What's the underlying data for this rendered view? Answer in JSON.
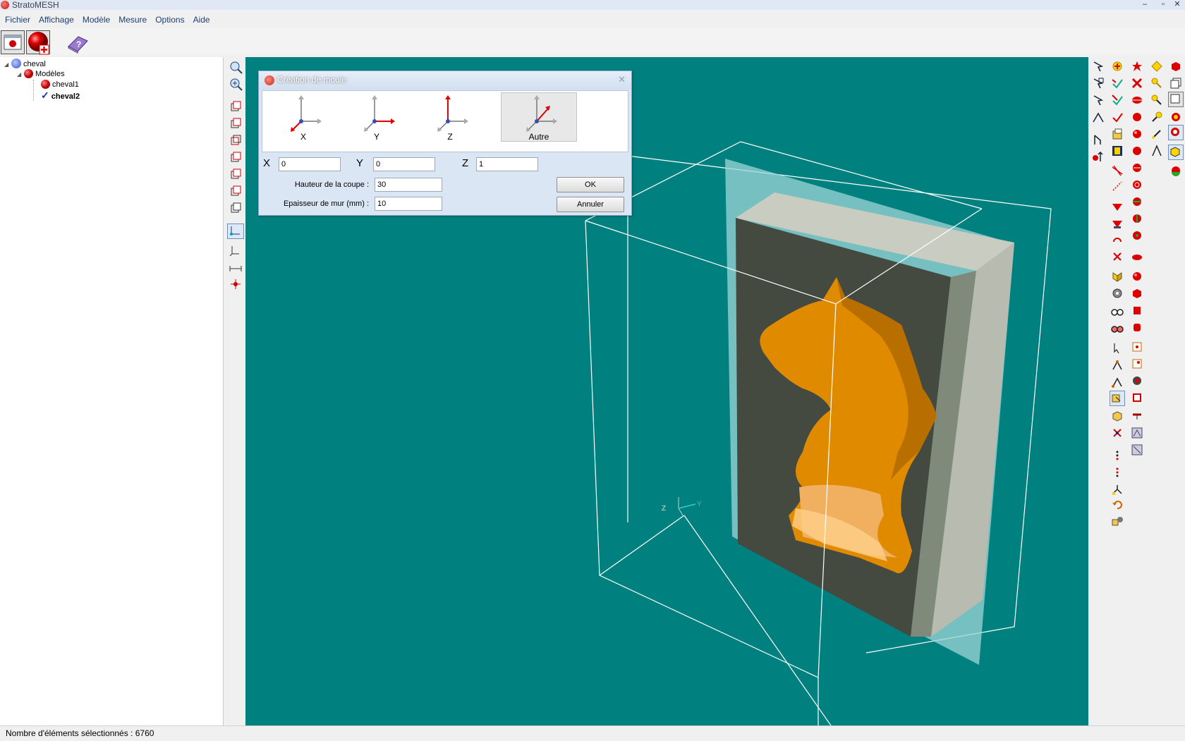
{
  "window": {
    "title": "StratoMESH",
    "controls": [
      "–",
      "▫",
      "✕"
    ]
  },
  "menu": [
    "Fichier",
    "Affichage",
    "Modèle",
    "Mesure",
    "Options",
    "Aide"
  ],
  "tree": {
    "root": "cheval",
    "group": "Modèles",
    "items": [
      "cheval1",
      "cheval2"
    ]
  },
  "dialog": {
    "title": "Création de moule",
    "axes": [
      "X",
      "Y",
      "Z",
      "Autre"
    ],
    "selected_axis": "Autre",
    "x_label": "X",
    "y_label": "Y",
    "z_label": "Z",
    "x_value": "0",
    "y_value": "0",
    "z_value": "1",
    "cut_height_label": "Hauteur de la coupe :",
    "cut_height_value": "30",
    "wall_label": "Epaisseur  de mur (mm) :",
    "wall_value": "10",
    "ok_label": "OK",
    "cancel_label": "Annuler"
  },
  "viewport": {
    "axis_labels": {
      "z": "Z",
      "y": "Y"
    },
    "background": "#00807f",
    "model_color": "#e08a00"
  },
  "status": {
    "text": "Nombre d'éléments sélectionnés : 6760"
  }
}
